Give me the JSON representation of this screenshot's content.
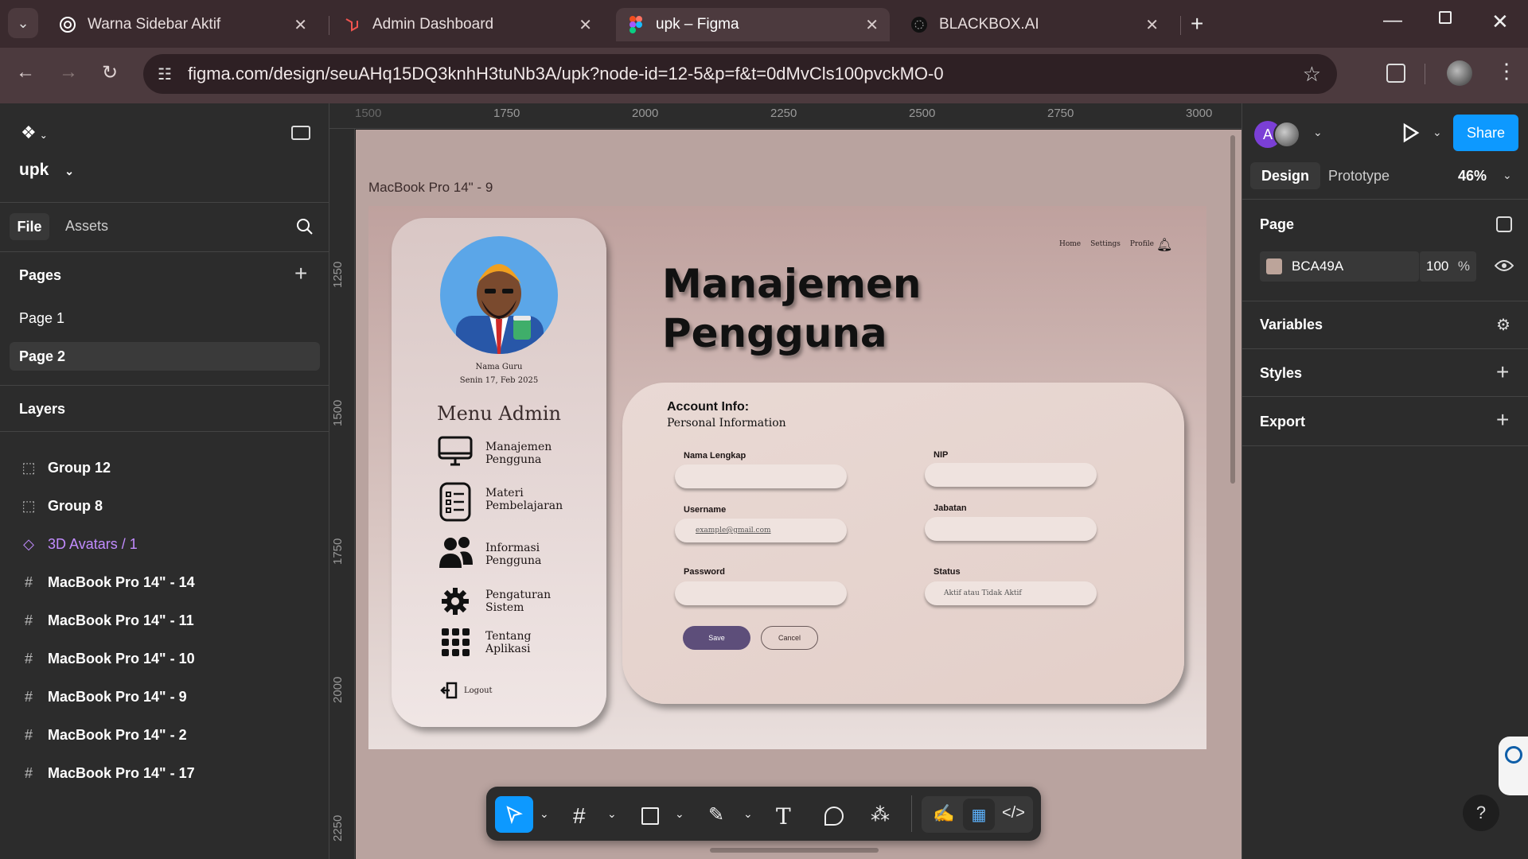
{
  "browser": {
    "tabs": [
      {
        "title": "Warna Sidebar Aktif"
      },
      {
        "title": "Admin Dashboard"
      },
      {
        "title": "upk – Figma"
      },
      {
        "title": "BLACKBOX.AI"
      }
    ],
    "url": "figma.com/design/seuAHq15DQ3knhH3tuNb3A/upk?node-id=12-5&p=f&t=0dMvCls100pvckMO-0"
  },
  "figma": {
    "file_name": "upk",
    "left_tabs": {
      "file": "File",
      "assets": "Assets"
    },
    "pages_header": "Pages",
    "pages": [
      "Page 1",
      "Page 2"
    ],
    "layers_header": "Layers",
    "layers": [
      {
        "name": "Group 12",
        "icon": "group-icon"
      },
      {
        "name": "Group 8",
        "icon": "group-icon"
      },
      {
        "name": "3D Avatars / 1",
        "icon": "component-instance-icon"
      },
      {
        "name": "MacBook Pro 14\" - 14",
        "icon": "frame-icon"
      },
      {
        "name": "MacBook Pro 14\" - 11",
        "icon": "frame-icon"
      },
      {
        "name": "MacBook Pro 14\" - 10",
        "icon": "frame-icon"
      },
      {
        "name": "MacBook Pro 14\" - 9",
        "icon": "frame-icon"
      },
      {
        "name": "MacBook Pro 14\" - 2",
        "icon": "frame-icon"
      },
      {
        "name": "MacBook Pro 14\" - 17",
        "icon": "frame-icon"
      }
    ],
    "ruler_top": [
      "1500",
      "1750",
      "2000",
      "2250",
      "2500",
      "2750",
      "3000"
    ],
    "ruler_left": [
      "1250",
      "1500",
      "1750",
      "2000",
      "2250"
    ],
    "frame_label": "MacBook Pro 14\" - 9",
    "right": {
      "avatar_letter": "A",
      "share": "Share",
      "tab_design": "Design",
      "tab_prototype": "Prototype",
      "zoom": "46%",
      "page_header": "Page",
      "page_color": "BCA49A",
      "page_opacity": "100",
      "percent": "%",
      "variables": "Variables",
      "styles": "Styles",
      "export": "Export"
    },
    "colors": {
      "accent": "#0d99ff",
      "page_bg": "#BCA49A"
    }
  },
  "design": {
    "nav": {
      "home": "Home",
      "settings": "Settings",
      "profile": "Profile"
    },
    "title_line1": "Manajemen",
    "title_line2": "Pengguna",
    "profile_name": "Nama Guru",
    "profile_date": "Senin 17, Feb 2025",
    "menu_title": "Menu Admin",
    "menu": [
      {
        "line1": "Manajemen",
        "line2": "Pengguna",
        "icon": "monitor-icon"
      },
      {
        "line1": "Materi",
        "line2": "Pembelajaran",
        "icon": "list-icon"
      },
      {
        "line1": "Informasi",
        "line2": "Pengguna",
        "icon": "users-icon"
      },
      {
        "line1": "Pengaturan",
        "line2": "Sistem",
        "icon": "gear-icon"
      },
      {
        "line1": "Tentang",
        "line2": "Aplikasi",
        "icon": "apps-grid-icon"
      }
    ],
    "logout": "Logout",
    "account_title": "Account Info:",
    "account_subtitle": "Personal Information",
    "fields": {
      "nama": "Nama Lengkap",
      "nip": "NIP",
      "username": "Username",
      "username_placeholder": "example@gmail.com",
      "jabatan": "Jabatan",
      "password": "Password",
      "status": "Status",
      "status_placeholder": "Aktif atau Tidak Aktif"
    },
    "save": "Save",
    "cancel": "Cancel",
    "colors": {
      "save_button": "#5d4e7a"
    }
  }
}
